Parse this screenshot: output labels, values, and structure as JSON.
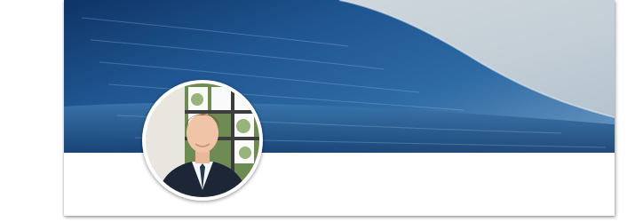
{
  "profile": {
    "cover_photo": {
      "subject": "ocean-wave-photo"
    },
    "avatar": {
      "subject": "profile-photo"
    }
  },
  "colors": {
    "page_background": "#ffffff",
    "card_background": "#ffffff",
    "sky": "#c9d3da",
    "wave_deep": "#123f74",
    "wave_mid": "#2d6aa8",
    "wave_light": "#7ea6c8"
  }
}
